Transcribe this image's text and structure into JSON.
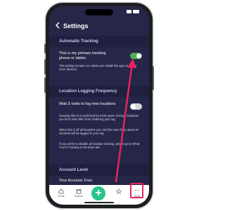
{
  "header": {
    "title": "Settings",
    "back_icon": "chevron-left-icon"
  },
  "status_bar": {
    "time": ""
  },
  "sections": {
    "automatic_tracking": {
      "heading": "Automatic Tracking",
      "primary_device_label": "This is my primary tracking phone or tablet.",
      "primary_device_toggle": true,
      "note": "This setting remains on unless you install this app on two or more devices."
    },
    "location_logging": {
      "heading": "Location Logging Frequency",
      "wait_label": "Wait 3 visits to log new locations",
      "wait_toggle": false,
      "note_1": "Keeping this on is preferred by most users. It keeps locations you don't visit often from cluttering your log.",
      "note_2": "When this is off all locations you visit (for more than about 15 minutes) will be logged to your log.",
      "note_3": "If you prefer to disable all location tracking, please go to What You're Tracking in the More tab."
    },
    "account": {
      "heading": "Account Level",
      "account_label": "Your Account: Free"
    }
  },
  "tabbar": {
    "home": "Home",
    "explore": "Explore",
    "fab": "+",
    "saved": "",
    "more": "More"
  },
  "colors": {
    "background": "#262748",
    "section": "#1f2040",
    "toggle_on": "#4caf50",
    "fab": "#2bc48a",
    "annotation": "#e3245f"
  }
}
